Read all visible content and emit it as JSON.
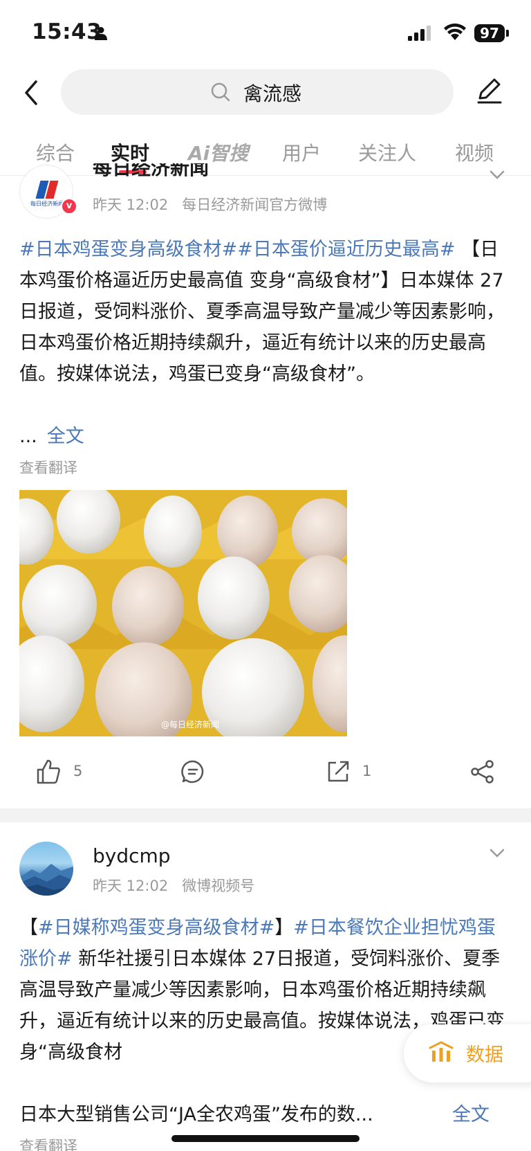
{
  "status_bar": {
    "time": "15:43",
    "battery": "97"
  },
  "header": {
    "search_query": "禽流感"
  },
  "tabs": [
    {
      "label": "综合"
    },
    {
      "label": "实时"
    },
    {
      "label": "Ai智搜"
    },
    {
      "label": "用户"
    },
    {
      "label": "关注人"
    },
    {
      "label": "视频"
    }
  ],
  "posts": [
    {
      "author": "每日经济新闻",
      "avatar_text": "每日经济新闻",
      "time": "昨天 12:02",
      "source": "每日经济新闻官方微博",
      "hashtags": "#日本鸡蛋变身高级食材##日本蛋价逼近历史最高#",
      "body": "【日本鸡蛋价格逼近历史最高值 变身“高级食材”】日本媒体 27日报道，受饲料涨价、夏季高温导致产量减少等因素影响，日本鸡蛋价格近期持续飙升，逼近有统计以来的历史最高值。按媒体说法，鸡蛋已变身“高级食材”。",
      "ellipsis": "...",
      "full_text_label": "全文",
      "translate_label": "查看翻译",
      "image_watermark": "@每日经济新闻",
      "likes": "5",
      "reposts": "1"
    },
    {
      "author": "bydcmp",
      "time": "昨天 12:02",
      "source": "微博视频号",
      "bracket_open": "【",
      "hashtag1": "#日媒称鸡蛋变身高级食材#",
      "bracket_close": "】",
      "hashtag2": "#日本餐饮企业担忧鸡蛋涨价#",
      "body": " 新华社援引日本媒体 27日报道，受饲料涨价、夏季高温导致产量减少等因素影响，日本鸡蛋价格近期持续飙升，逼近有统计以来的历史最高值。按媒体说法，鸡蛋已变身“高级食材",
      "body2": "日本大型销售公司“JA全农鸡蛋”发布的数...",
      "full_text_label": "全文",
      "translate_label": "查看翻译"
    }
  ],
  "floating_button": {
    "label": "数据"
  },
  "colors": {
    "accent": "#f2374d",
    "link": "#4a78b8",
    "data_button": "#f0a020"
  }
}
